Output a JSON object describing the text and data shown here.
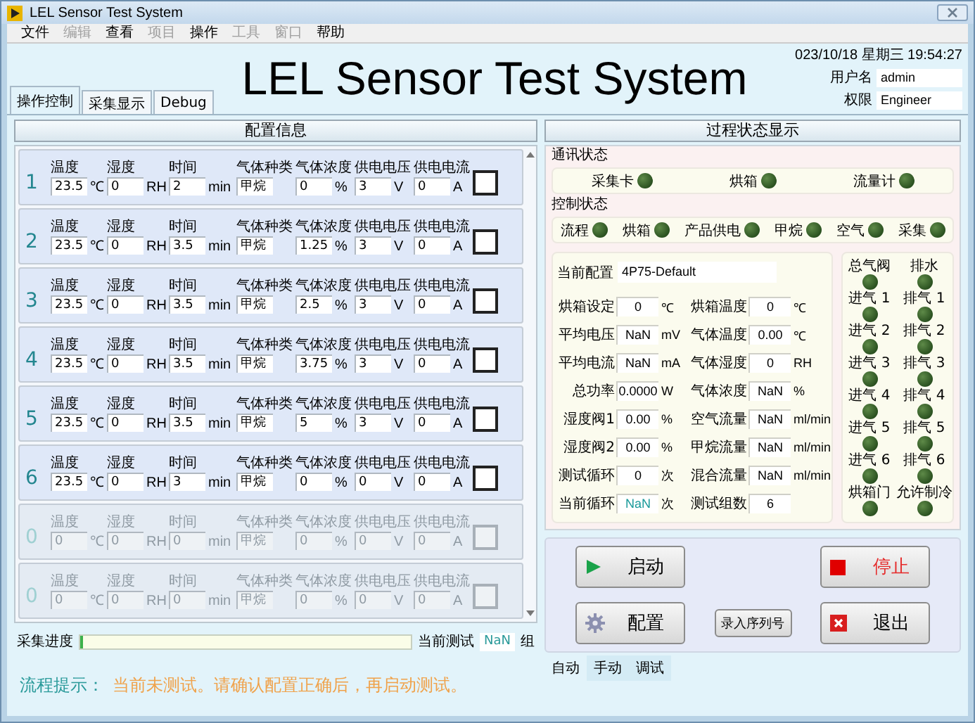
{
  "window": {
    "title": "LEL Sensor Test  System"
  },
  "menu": [
    {
      "label": "文件",
      "disabled": false
    },
    {
      "label": "编辑",
      "disabled": true
    },
    {
      "label": "查看",
      "disabled": false
    },
    {
      "label": "项目",
      "disabled": true
    },
    {
      "label": "操作",
      "disabled": false
    },
    {
      "label": "工具",
      "disabled": true
    },
    {
      "label": "窗口",
      "disabled": true
    },
    {
      "label": "帮助",
      "disabled": false
    }
  ],
  "header": {
    "title": "LEL Sensor Test System",
    "datetime": "023/10/18 星期三 19:54:27",
    "user_label": "用户名",
    "user": "admin",
    "role_label": "权限",
    "role": "Engineer"
  },
  "tabs": [
    {
      "label": "操作控制",
      "selected": true
    },
    {
      "label": "采集显示",
      "selected": false
    },
    {
      "label": "Debug",
      "selected": false
    }
  ],
  "config_panel": {
    "title": "配置信息",
    "rows": [
      {
        "number": "1",
        "disabled": false,
        "checked": false,
        "fields": [
          {
            "label": "温度",
            "value": "23.5",
            "unit": "℃"
          },
          {
            "label": "湿度",
            "value": "0",
            "unit": "RH"
          },
          {
            "label": "时间",
            "value": "2",
            "unit": "min"
          },
          {
            "label": "气体种类",
            "value": "甲烷"
          },
          {
            "label": "气体浓度",
            "value": "0",
            "unit": "%"
          },
          {
            "label": "供电电压",
            "value": "3",
            "unit": "V"
          },
          {
            "label": "供电电流",
            "value": "0",
            "unit": "A"
          }
        ]
      },
      {
        "number": "2",
        "disabled": false,
        "checked": false,
        "fields": [
          {
            "label": "温度",
            "value": "23.5",
            "unit": "℃"
          },
          {
            "label": "湿度",
            "value": "0",
            "unit": "RH"
          },
          {
            "label": "时间",
            "value": "3.5",
            "unit": "min"
          },
          {
            "label": "气体种类",
            "value": "甲烷"
          },
          {
            "label": "气体浓度",
            "value": "1.25",
            "unit": "%"
          },
          {
            "label": "供电电压",
            "value": "3",
            "unit": "V"
          },
          {
            "label": "供电电流",
            "value": "0",
            "unit": "A"
          }
        ]
      },
      {
        "number": "3",
        "disabled": false,
        "checked": false,
        "fields": [
          {
            "label": "温度",
            "value": "23.5",
            "unit": "℃"
          },
          {
            "label": "湿度",
            "value": "0",
            "unit": "RH"
          },
          {
            "label": "时间",
            "value": "3.5",
            "unit": "min"
          },
          {
            "label": "气体种类",
            "value": "甲烷"
          },
          {
            "label": "气体浓度",
            "value": "2.5",
            "unit": "%"
          },
          {
            "label": "供电电压",
            "value": "3",
            "unit": "V"
          },
          {
            "label": "供电电流",
            "value": "0",
            "unit": "A"
          }
        ]
      },
      {
        "number": "4",
        "disabled": false,
        "checked": false,
        "fields": [
          {
            "label": "温度",
            "value": "23.5",
            "unit": "℃"
          },
          {
            "label": "湿度",
            "value": "0",
            "unit": "RH"
          },
          {
            "label": "时间",
            "value": "3.5",
            "unit": "min"
          },
          {
            "label": "气体种类",
            "value": "甲烷"
          },
          {
            "label": "气体浓度",
            "value": "3.75",
            "unit": "%"
          },
          {
            "label": "供电电压",
            "value": "3",
            "unit": "V"
          },
          {
            "label": "供电电流",
            "value": "0",
            "unit": "A"
          }
        ]
      },
      {
        "number": "5",
        "disabled": false,
        "checked": false,
        "fields": [
          {
            "label": "温度",
            "value": "23.5",
            "unit": "℃"
          },
          {
            "label": "湿度",
            "value": "0",
            "unit": "RH"
          },
          {
            "label": "时间",
            "value": "3.5",
            "unit": "min"
          },
          {
            "label": "气体种类",
            "value": "甲烷"
          },
          {
            "label": "气体浓度",
            "value": "5",
            "unit": "%"
          },
          {
            "label": "供电电压",
            "value": "3",
            "unit": "V"
          },
          {
            "label": "供电电流",
            "value": "0",
            "unit": "A"
          }
        ]
      },
      {
        "number": "6",
        "disabled": false,
        "checked": false,
        "fields": [
          {
            "label": "温度",
            "value": "23.5",
            "unit": "℃"
          },
          {
            "label": "湿度",
            "value": "0",
            "unit": "RH"
          },
          {
            "label": "时间",
            "value": "3",
            "unit": "min"
          },
          {
            "label": "气体种类",
            "value": "甲烷"
          },
          {
            "label": "气体浓度",
            "value": "0",
            "unit": "%"
          },
          {
            "label": "供电电压",
            "value": "0",
            "unit": "V"
          },
          {
            "label": "供电电流",
            "value": "0",
            "unit": "A"
          }
        ]
      },
      {
        "number": "0",
        "disabled": true,
        "checked": false,
        "fields": [
          {
            "label": "温度",
            "value": "0",
            "unit": "℃"
          },
          {
            "label": "湿度",
            "value": "0",
            "unit": "RH"
          },
          {
            "label": "时间",
            "value": "0",
            "unit": "min"
          },
          {
            "label": "气体种类",
            "value": "甲烷"
          },
          {
            "label": "气体浓度",
            "value": "0",
            "unit": "%"
          },
          {
            "label": "供电电压",
            "value": "0",
            "unit": "V"
          },
          {
            "label": "供电电流",
            "value": "0",
            "unit": "A"
          }
        ]
      },
      {
        "number": "0",
        "disabled": true,
        "checked": false,
        "fields": [
          {
            "label": "温度",
            "value": "0",
            "unit": "℃"
          },
          {
            "label": "湿度",
            "value": "0",
            "unit": "RH"
          },
          {
            "label": "时间",
            "value": "0",
            "unit": "min"
          },
          {
            "label": "气体种类",
            "value": "甲烷"
          },
          {
            "label": "气体浓度",
            "value": "0",
            "unit": "%"
          },
          {
            "label": "供电电压",
            "value": "0",
            "unit": "V"
          },
          {
            "label": "供电电流",
            "value": "0",
            "unit": "A"
          }
        ]
      }
    ]
  },
  "progress": {
    "label": "采集进度",
    "level": 0.01,
    "current_label": "当前测试",
    "current_value": "NaN",
    "current_unit": "组"
  },
  "hint": {
    "label": "流程提示：",
    "message": "当前未测试。请确认配置正确后，再启动测试。"
  },
  "status_panel": {
    "title": "过程状态显示",
    "comm_label": "通讯状态",
    "comm": [
      {
        "label": "采集卡",
        "on": false
      },
      {
        "label": "烘箱",
        "on": false
      },
      {
        "label": "流量计",
        "on": false
      }
    ],
    "control_label": "控制状态",
    "control": [
      {
        "label": "流程",
        "on": false
      },
      {
        "label": "烘箱",
        "on": false
      },
      {
        "label": "产品供电",
        "on": false
      },
      {
        "label": "甲烷",
        "on": false
      },
      {
        "label": "空气",
        "on": false
      },
      {
        "label": "采集",
        "on": false
      }
    ],
    "config_label": "当前配置",
    "config_value": "4P75-Default",
    "readings": [
      {
        "label": "烘箱设定",
        "value": "0",
        "unit": "℃"
      },
      {
        "label": "烘箱温度",
        "value": "0",
        "unit": "℃"
      },
      {
        "label": "平均电压",
        "value": "NaN",
        "unit": "mV"
      },
      {
        "label": "气体温度",
        "value": "0.00",
        "unit": "℃"
      },
      {
        "label": "平均电流",
        "value": "NaN",
        "unit": "mA"
      },
      {
        "label": "气体湿度",
        "value": "0",
        "unit": "RH"
      },
      {
        "label": "总功率",
        "value": "0.0000",
        "unit": "W"
      },
      {
        "label": "气体浓度",
        "value": "NaN",
        "unit": "%"
      },
      {
        "label": "湿度阀1",
        "value": "0.00",
        "unit": "%"
      },
      {
        "label": "空气流量",
        "value": "NaN",
        "unit": "ml/min"
      },
      {
        "label": "湿度阀2",
        "value": "0.00",
        "unit": "%"
      },
      {
        "label": "甲烷流量",
        "value": "NaN",
        "unit": "ml/min"
      },
      {
        "label": "测试循环",
        "value": "0",
        "unit": "次"
      },
      {
        "label": "混合流量",
        "value": "NaN",
        "unit": "ml/min"
      },
      {
        "label": "当前循环",
        "value": "NaN",
        "unit": "次",
        "color": "#1a9a9a"
      },
      {
        "label": "测试组数",
        "value": "6"
      }
    ],
    "valves": [
      {
        "label": "总气阀",
        "on": false
      },
      {
        "label": "排水",
        "on": false
      },
      {
        "label": "进气 1",
        "on": false
      },
      {
        "label": "排气 1",
        "on": false
      },
      {
        "label": "进气 2",
        "on": false
      },
      {
        "label": "排气 2",
        "on": false
      },
      {
        "label": "进气 3",
        "on": false
      },
      {
        "label": "排气 3",
        "on": false
      },
      {
        "label": "进气 4",
        "on": false
      },
      {
        "label": "排气 4",
        "on": false
      },
      {
        "label": "进气 5",
        "on": false
      },
      {
        "label": "排气 5",
        "on": false
      },
      {
        "label": "进气 6",
        "on": false
      },
      {
        "label": "排气 6",
        "on": false
      },
      {
        "label": "烘箱门",
        "on": false
      },
      {
        "label": "允许制冷",
        "on": false
      }
    ]
  },
  "buttons": [
    {
      "kind": "start",
      "label": "启动"
    },
    {
      "kind": "stop",
      "label": "停止"
    },
    {
      "kind": "config",
      "label": "配置"
    },
    {
      "kind": "serial",
      "label": "录入序列号"
    },
    {
      "kind": "exit",
      "label": "退出"
    }
  ],
  "mode_tabs": [
    {
      "label": "自动",
      "selected": true
    },
    {
      "label": "手动",
      "selected": false
    },
    {
      "label": "调试",
      "selected": false
    }
  ]
}
